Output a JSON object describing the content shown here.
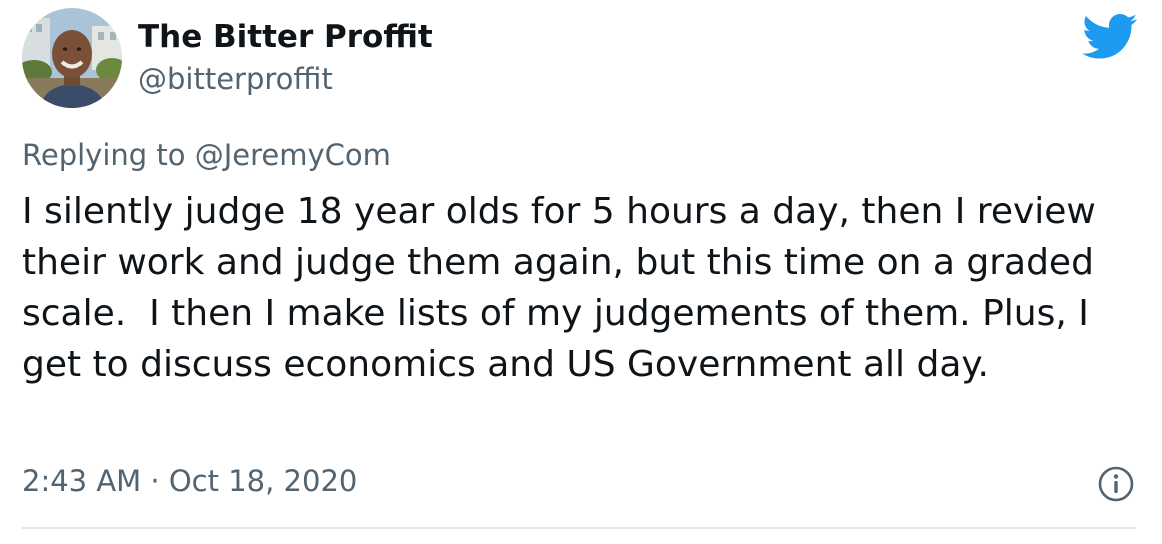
{
  "author": {
    "display_name": "The Bitter Proffit",
    "handle": "@bitterproffit",
    "avatar_icon": "profile-photo"
  },
  "reply": {
    "prefix": "Replying to ",
    "mention": "@JeremyCom"
  },
  "tweet": {
    "text": "I silently judge 18 year olds for 5 hours a day, then I review their work and judge them again, but this time on a graded scale.  I then I make lists of my judgements of them. Plus, I get to discuss economics and US Government all day.",
    "timestamp": "2:43 AM · Oct 18, 2020"
  },
  "icons": {
    "brand": "twitter-bird-icon",
    "info": "info-icon"
  },
  "colors": {
    "brand_blue": "#1d9bf0",
    "secondary_text": "#536471",
    "primary_text": "#0f1419",
    "divider": "#e1e6ea"
  }
}
